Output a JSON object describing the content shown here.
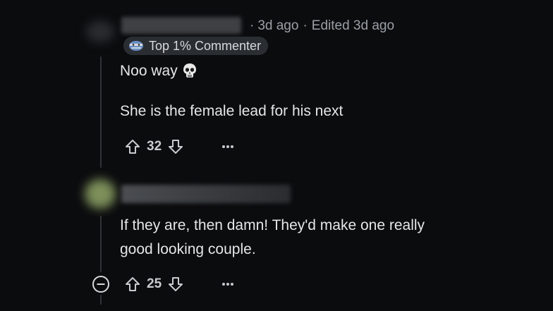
{
  "comment1": {
    "time": "3d ago",
    "edited": "Edited 3d ago",
    "flair": "Top 1% Commenter",
    "line1": "Noo way",
    "line2": "She is the female lead for his next",
    "score": "32"
  },
  "comment2": {
    "line1": "If they are, then damn! They'd make one really",
    "line2": "good looking couple.",
    "score": "25"
  }
}
